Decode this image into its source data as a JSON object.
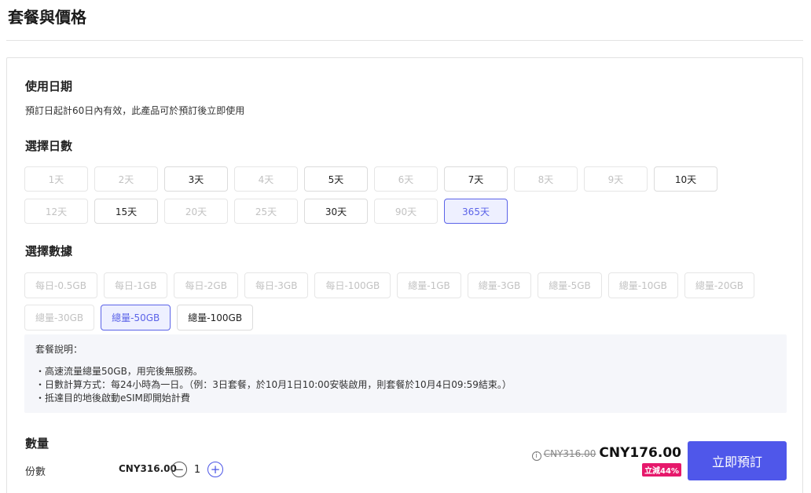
{
  "page_title": "套餐與價格",
  "usage": {
    "title": "使用日期",
    "description": "預訂日起計60日內有效，此產品可於預訂後立即使用"
  },
  "days": {
    "title": "選擇日數",
    "rows": [
      [
        {
          "label": "1天",
          "state": "disabled"
        },
        {
          "label": "2天",
          "state": "disabled"
        },
        {
          "label": "3天",
          "state": "normal"
        },
        {
          "label": "4天",
          "state": "disabled"
        },
        {
          "label": "5天",
          "state": "normal"
        },
        {
          "label": "6天",
          "state": "disabled"
        },
        {
          "label": "7天",
          "state": "normal"
        },
        {
          "label": "8天",
          "state": "disabled"
        },
        {
          "label": "9天",
          "state": "disabled"
        },
        {
          "label": "10天",
          "state": "normal"
        }
      ],
      [
        {
          "label": "12天",
          "state": "disabled"
        },
        {
          "label": "15天",
          "state": "normal"
        },
        {
          "label": "20天",
          "state": "disabled"
        },
        {
          "label": "25天",
          "state": "disabled"
        },
        {
          "label": "30天",
          "state": "normal"
        },
        {
          "label": "90天",
          "state": "disabled"
        },
        {
          "label": "365天",
          "state": "selected"
        }
      ]
    ]
  },
  "data_plans": {
    "title": "選擇數據",
    "rows": [
      [
        {
          "label": "每日-0.5GB",
          "state": "disabled"
        },
        {
          "label": "每日-1GB",
          "state": "disabled"
        },
        {
          "label": "每日-2GB",
          "state": "disabled"
        },
        {
          "label": "每日-3GB",
          "state": "disabled"
        },
        {
          "label": "每日-100GB",
          "state": "disabled"
        },
        {
          "label": "總量-1GB",
          "state": "disabled"
        },
        {
          "label": "總量-3GB",
          "state": "disabled"
        },
        {
          "label": "總量-5GB",
          "state": "disabled"
        },
        {
          "label": "總量-10GB",
          "state": "disabled"
        },
        {
          "label": "總量-20GB",
          "state": "disabled"
        }
      ],
      [
        {
          "label": "總量-30GB",
          "state": "disabled"
        },
        {
          "label": "總量-50GB",
          "state": "selected"
        },
        {
          "label": "總量-100GB",
          "state": "normal"
        }
      ]
    ]
  },
  "plan_description": {
    "title": "套餐說明：",
    "lines": [
      "・高速流量總量50GB，用完後無服務。",
      "・日數計算方式：每24小時為一日。（例：3日套餐，於10月1日10:00安裝啟用，則套餐於10月4日09:59結束。）",
      "・抵達目的地後啟動eSIM即開始計費"
    ]
  },
  "quantity": {
    "title": "數量",
    "label": "份數",
    "unit_price": "CNY316.00",
    "value": "1",
    "minus_symbol": "−",
    "plus_symbol": "+"
  },
  "price": {
    "info_symbol": "i",
    "original": "CNY316.00",
    "current": "CNY176.00",
    "discount": "立減44%"
  },
  "book_button": "立即預訂",
  "colors": {
    "accent": "#4f57ea",
    "selected_bg": "#eef0ff",
    "discount_badge": "#e6186b"
  },
  "icons": {
    "info": "info-icon",
    "minus": "minus-circle-icon",
    "plus": "plus-circle-icon"
  }
}
